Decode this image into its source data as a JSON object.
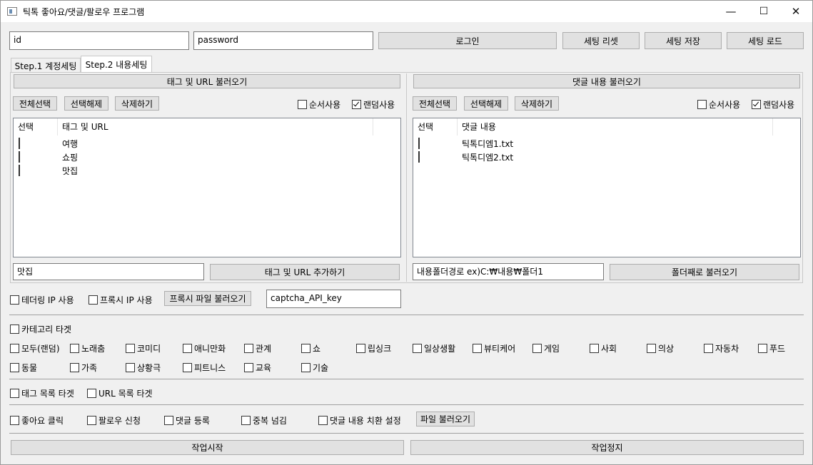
{
  "window": {
    "title": "틱톡 좋아요/댓글/팔로우 프로그램",
    "minimize_glyph": "—",
    "maximize_glyph": "☐",
    "close_glyph": "✕"
  },
  "login": {
    "id_value": "id",
    "password_value": "password",
    "login_label": "로그인",
    "reset_label": "세팅 리셋",
    "save_label": "세팅 저장",
    "load_label": "세팅 로드"
  },
  "tabs": [
    {
      "label": "Step.1 계정세팅",
      "active": false
    },
    {
      "label": "Step.2 내용세팅",
      "active": true
    }
  ],
  "left_panel": {
    "load_label": "태그 및 URL 불러오기",
    "select_all": "전체선택",
    "deselect": "선택해제",
    "delete": "삭제하기",
    "seq_label": "순서사용",
    "seq_checked": false,
    "random_label": "랜덤사용",
    "random_checked": true,
    "col_select": "선택",
    "col_name": "태그 및 URL",
    "rows": [
      "여행",
      "쇼핑",
      "맛집"
    ],
    "input_value": "맛집",
    "add_label": "태그 및 URL 추가하기"
  },
  "right_panel": {
    "load_label": "댓글 내용 불러오기",
    "select_all": "전체선택",
    "deselect": "선택해제",
    "delete": "삭제하기",
    "seq_label": "순서사용",
    "seq_checked": false,
    "random_label": "랜덤사용",
    "random_checked": true,
    "col_select": "선택",
    "col_name": "댓글 내용",
    "rows": [
      "틱톡디엠1.txt",
      "틱톡디엠2.txt"
    ],
    "folder_value": "내용폴더경로 ex)C:₩내용₩폴더1",
    "folder_load_label": "폴더째로 불러오기"
  },
  "options": {
    "tethering_label": "테더링 IP 사용",
    "proxy_label": "프록시 IP 사용",
    "proxy_file_label": "프록시 파일 불러오기",
    "captcha_value": "captcha_API_key"
  },
  "category": {
    "target_label": "카테고리 타겟",
    "row1": [
      "모두(랜덤)",
      "노래춤",
      "코미디",
      "애니만화",
      "관계",
      "쇼",
      "립싱크",
      "일상생활",
      "뷰티케어",
      "게임",
      "사회",
      "의상",
      "자동차",
      "푸드"
    ],
    "row2": [
      "동물",
      "가족",
      "상황극",
      "피트니스",
      "교육",
      "기술"
    ]
  },
  "targets": {
    "tag_list_label": "태그 목록 타겟",
    "url_list_label": "URL 목록 타겟"
  },
  "actions": {
    "like_label": "좋아요 클릭",
    "follow_label": "팔로우 신청",
    "comment_label": "댓글 등록",
    "skip_label": "중복 넘김",
    "replace_label": "댓글 내용 치환 설정",
    "file_load_label": "파일 불러오기"
  },
  "footer": {
    "start_label": "작업시작",
    "stop_label": "작업정지"
  }
}
